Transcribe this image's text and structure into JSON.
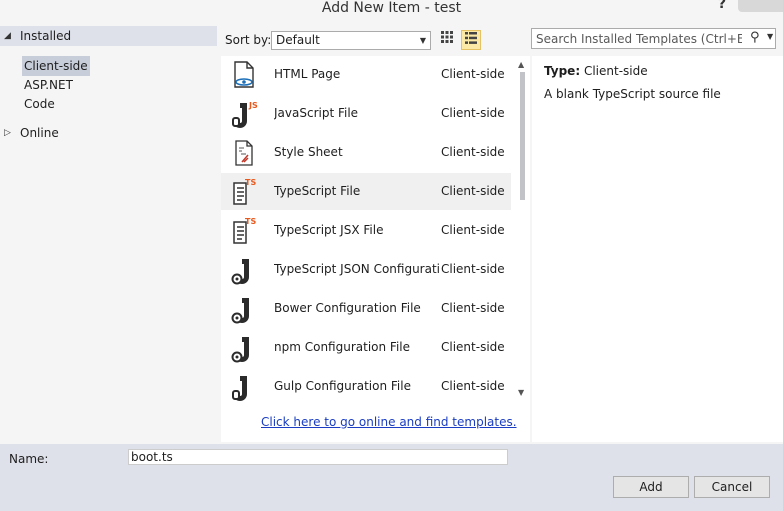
{
  "window": {
    "title": "Add New Item - test",
    "help": "?"
  },
  "tree": {
    "installed": "Installed",
    "children": [
      "Client-side",
      "ASP.NET",
      "Code"
    ],
    "online": "Online"
  },
  "toolbar": {
    "sort_label": "Sort by:",
    "sort_value": "Default",
    "search_placeholder": "Search Installed Templates (Ctrl+E)"
  },
  "items": [
    {
      "name": "HTML Page",
      "category": "Client-side",
      "icon": "html-icon"
    },
    {
      "name": "JavaScript File",
      "category": "Client-side",
      "icon": "js-icon"
    },
    {
      "name": "Style Sheet",
      "category": "Client-side",
      "icon": "css-icon"
    },
    {
      "name": "TypeScript File",
      "category": "Client-side",
      "icon": "ts-icon"
    },
    {
      "name": "TypeScript JSX File",
      "category": "Client-side",
      "icon": "ts-icon"
    },
    {
      "name": "TypeScript JSON Configurati...",
      "category": "Client-side",
      "icon": "config-icon"
    },
    {
      "name": "Bower Configuration File",
      "category": "Client-side",
      "icon": "config-icon"
    },
    {
      "name": "npm Configuration File",
      "category": "Client-side",
      "icon": "config-icon"
    },
    {
      "name": "Gulp Configuration File",
      "category": "Client-side",
      "icon": "js-icon"
    }
  ],
  "online_link": "Click here to go online and find templates.",
  "details": {
    "type_label": "Type:",
    "type_value": "Client-side",
    "description": "A blank TypeScript source file"
  },
  "name_field": {
    "label": "Name:",
    "value": "boot.ts"
  },
  "buttons": {
    "add": "Add",
    "cancel": "Cancel"
  },
  "colors": {
    "link": "#1a3dc1",
    "selection": "#c7cdd9",
    "js_accent": "#e8581c",
    "header_bg": "#dee1ea"
  }
}
